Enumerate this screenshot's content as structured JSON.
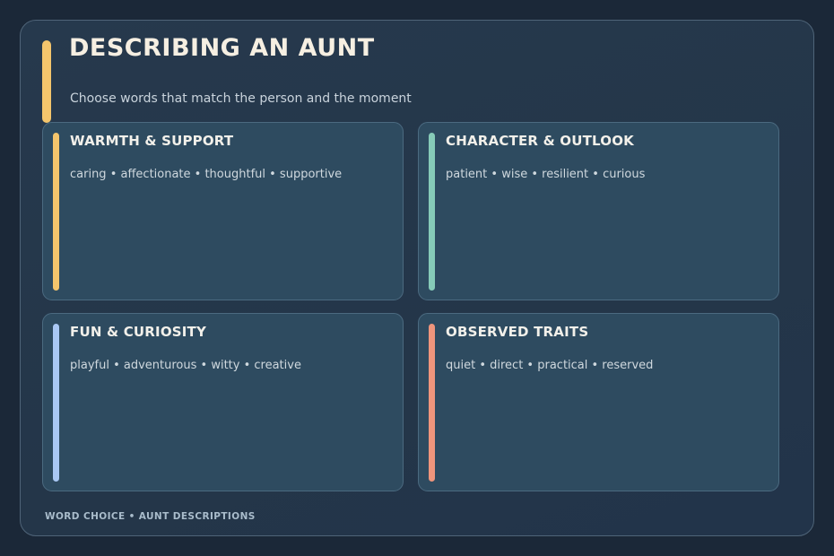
{
  "header": {
    "title": "DESCRIBING AN AUNT",
    "subtitle": "Choose words that match the person and the moment",
    "accent_color": "#f4c56c"
  },
  "cards": [
    {
      "title": "WARMTH & SUPPORT",
      "words": "caring • affectionate • thoughtful • supportive",
      "accent_color": "#f4c56c"
    },
    {
      "title": "CHARACTER & OUTLOOK",
      "words": "patient • wise • resilient • curious",
      "accent_color": "#86cbb8"
    },
    {
      "title": "FUN & CURIOSITY",
      "words": "playful • adventurous • witty • creative",
      "accent_color": "#a9c8f4"
    },
    {
      "title": "OBSERVED TRAITS",
      "words": "quiet • direct • practical • reserved",
      "accent_color": "#ef957c"
    }
  ],
  "footer": {
    "caption": "WORD CHOICE • AUNT DESCRIPTIONS"
  }
}
